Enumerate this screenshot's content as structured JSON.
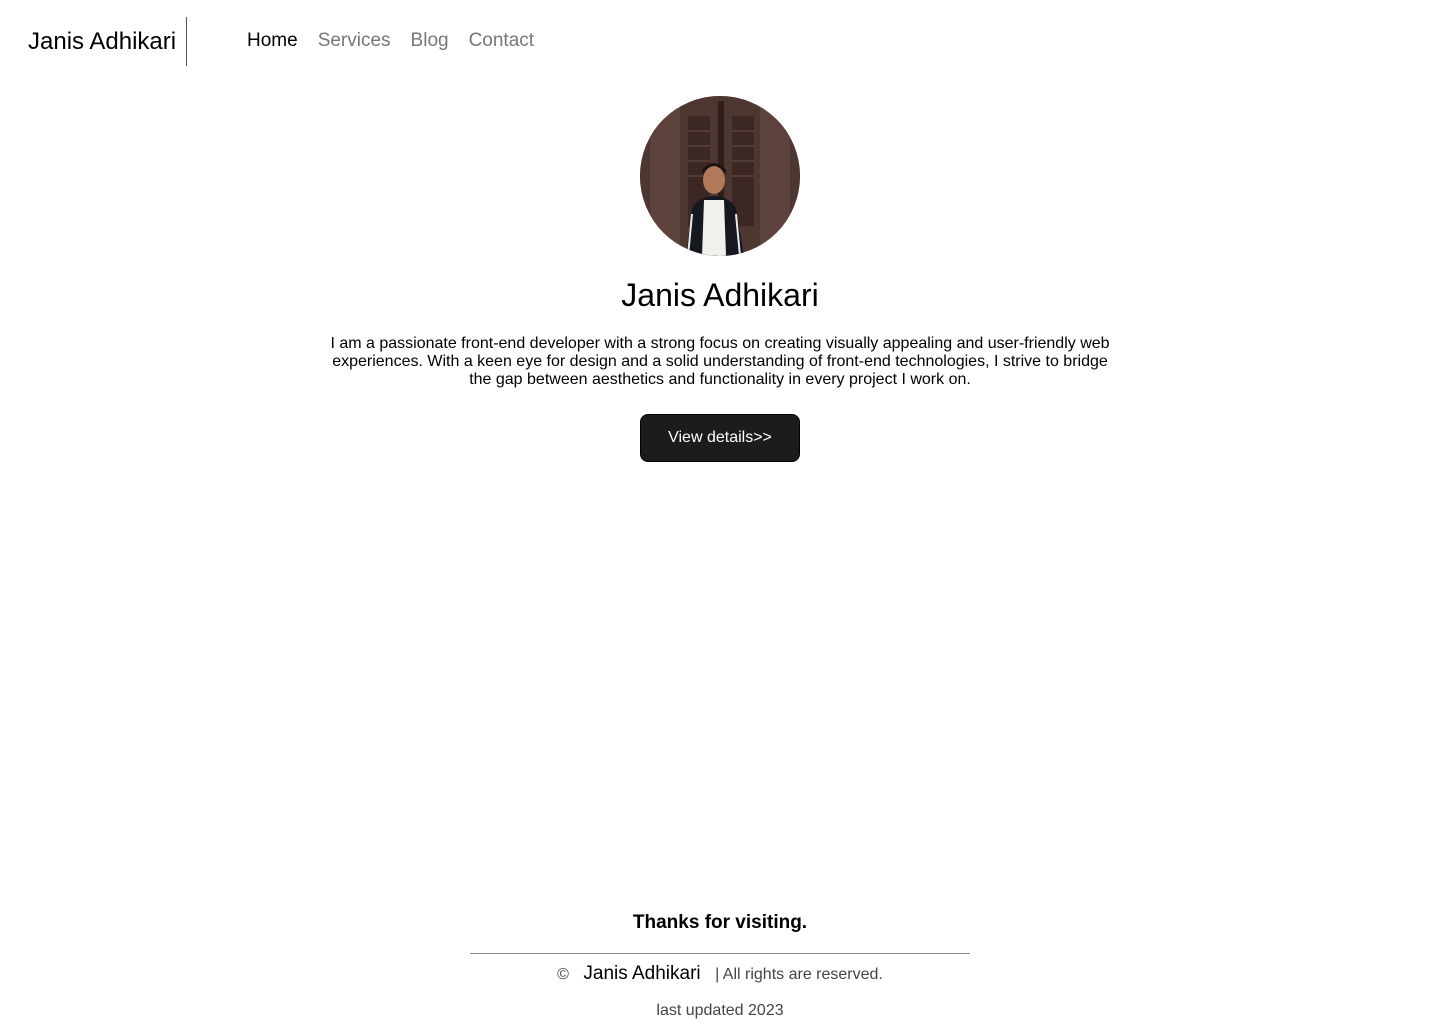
{
  "header": {
    "brand": "Janis Adhikari",
    "nav": [
      {
        "label": "Home",
        "active": true
      },
      {
        "label": "Services",
        "active": false
      },
      {
        "label": "Blog",
        "active": false
      },
      {
        "label": "Contact",
        "active": false
      }
    ]
  },
  "hero": {
    "name": "Janis Adhikari",
    "bio": "I am a passionate front-end developer with a strong focus on creating visually appealing and user-friendly web experiences. With a keen eye for design and a solid understanding of front-end technologies, I strive to bridge the gap between aesthetics and functionality in every project I work on.",
    "cta_label": "View details>>"
  },
  "footer": {
    "thanks": "Thanks for visiting.",
    "copyright_symbol": "©",
    "owner": "Janis Adhikari",
    "rights": "| All rights are reserved.",
    "updated": "last updated 2023"
  },
  "colors": {
    "nav_active": "#000000",
    "nav_inactive": "#777777",
    "button_bg": "#1c1c1c",
    "button_text": "#ffffff"
  }
}
